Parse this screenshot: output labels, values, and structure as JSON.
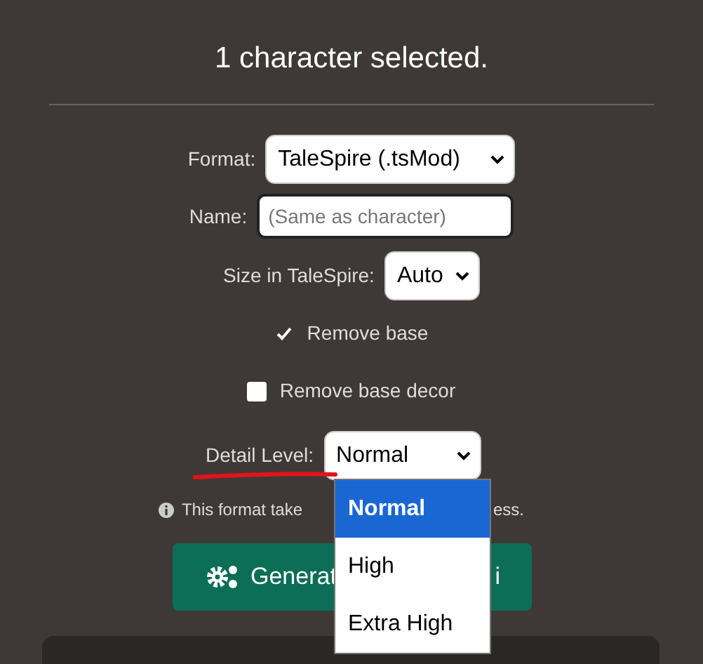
{
  "heading": "1 character selected.",
  "format": {
    "label": "Format:",
    "value": "TaleSpire (.tsMod)"
  },
  "name": {
    "label": "Name:",
    "placeholder": "(Same as character)"
  },
  "size": {
    "label": "Size in TaleSpire:",
    "value": "Auto"
  },
  "checkboxes": [
    {
      "label": "Remove base",
      "checked": true
    },
    {
      "label": "Remove base decor",
      "checked": false
    }
  ],
  "detail": {
    "label": "Detail Level:",
    "value": "Normal",
    "expanded": true,
    "options": [
      {
        "label": "Normal",
        "selected": true
      },
      {
        "label": "High",
        "selected": false
      },
      {
        "label": "Extra High",
        "selected": false
      }
    ]
  },
  "info": {
    "before": "This format take",
    "after": "ess."
  },
  "generate_button": {
    "before": "Generat",
    "after": "i"
  }
}
